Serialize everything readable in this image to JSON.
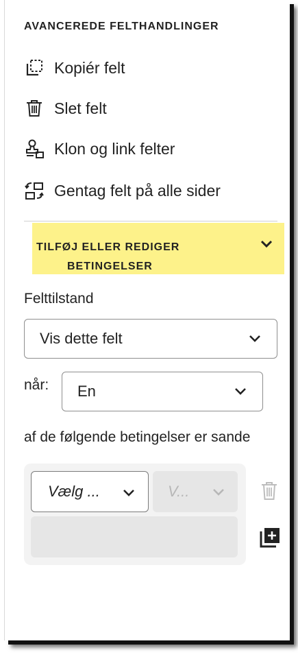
{
  "panel": {
    "section_title": "AVANCEREDE FELTHANDLINGER",
    "actions": [
      {
        "label": "Kopiér felt",
        "icon": "copy-field-icon"
      },
      {
        "label": "Slet felt",
        "icon": "trash-icon"
      },
      {
        "label": "Klon og link felter",
        "icon": "clone-stamp-icon"
      },
      {
        "label": "Gentag felt på alle sider",
        "icon": "repeat-pages-icon"
      }
    ],
    "conditions_header": {
      "line1": "TILFØJ ELLER REDIGER",
      "line2": "BETINGELSER",
      "highlight_color": "#fdf28a"
    },
    "field_state": {
      "label": "Felttilstand",
      "value": "Vis dette felt"
    },
    "when": {
      "label": "når:",
      "value": "En"
    },
    "conditions_text": "af de følgende betingelser er sande",
    "rule": {
      "field_select": "Vælg ...",
      "operator_select": "V..."
    }
  }
}
